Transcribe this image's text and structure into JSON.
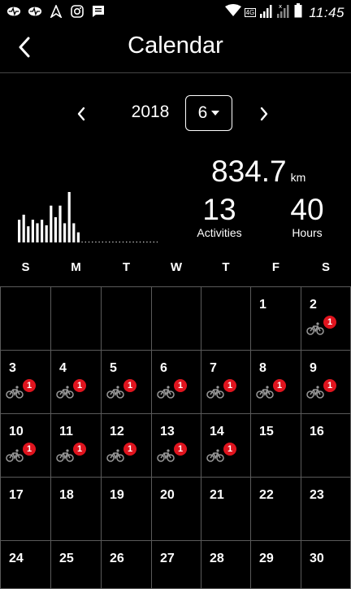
{
  "status_bar": {
    "time": "11:45",
    "network": "4G",
    "icons": [
      "activity-icon",
      "activity-icon",
      "navigation-icon",
      "instagram-icon",
      "message-icon",
      "wifi-icon",
      "signal-icon",
      "signal-no-sim-icon",
      "battery-icon"
    ]
  },
  "header": {
    "title": "Calendar",
    "back_icon": "chevron-left-icon"
  },
  "selector": {
    "year": "2018",
    "month": "6",
    "prev_icon": "chevron-left-icon",
    "next_icon": "chevron-right-icon",
    "dropdown_icon": "caret-down-icon"
  },
  "summary": {
    "distance": "834.7",
    "distance_unit": "km",
    "activities": "13",
    "activities_label": "Activities",
    "hours": "40",
    "hours_label": "Hours"
  },
  "weekdays": [
    "S",
    "M",
    "T",
    "W",
    "T",
    "F",
    "S"
  ],
  "calendar": {
    "weeks": [
      [
        "",
        "",
        "",
        "",
        "",
        "1",
        "2"
      ],
      [
        "3",
        "4",
        "5",
        "6",
        "7",
        "8",
        "9"
      ],
      [
        "10",
        "11",
        "12",
        "13",
        "14",
        "15",
        "16"
      ],
      [
        "17",
        "18",
        "19",
        "20",
        "21",
        "22",
        "23"
      ],
      [
        "24",
        "25",
        "26",
        "27",
        "28",
        "29",
        "30"
      ]
    ],
    "activity_days": [
      "2",
      "3",
      "4",
      "5",
      "6",
      "7",
      "8",
      "9",
      "10",
      "11",
      "12",
      "13",
      "14"
    ],
    "activity_count": "1",
    "activity_icon": "bicycle-icon",
    "badge_color": "#e0141e"
  },
  "mini_chart": {
    "values": [
      0.45,
      0.55,
      0.32,
      0.45,
      0.38,
      0.45,
      0.34,
      0.73,
      0.5,
      0.73,
      0.38,
      1.0,
      0.38,
      0.2
    ],
    "empty_days": 16
  }
}
